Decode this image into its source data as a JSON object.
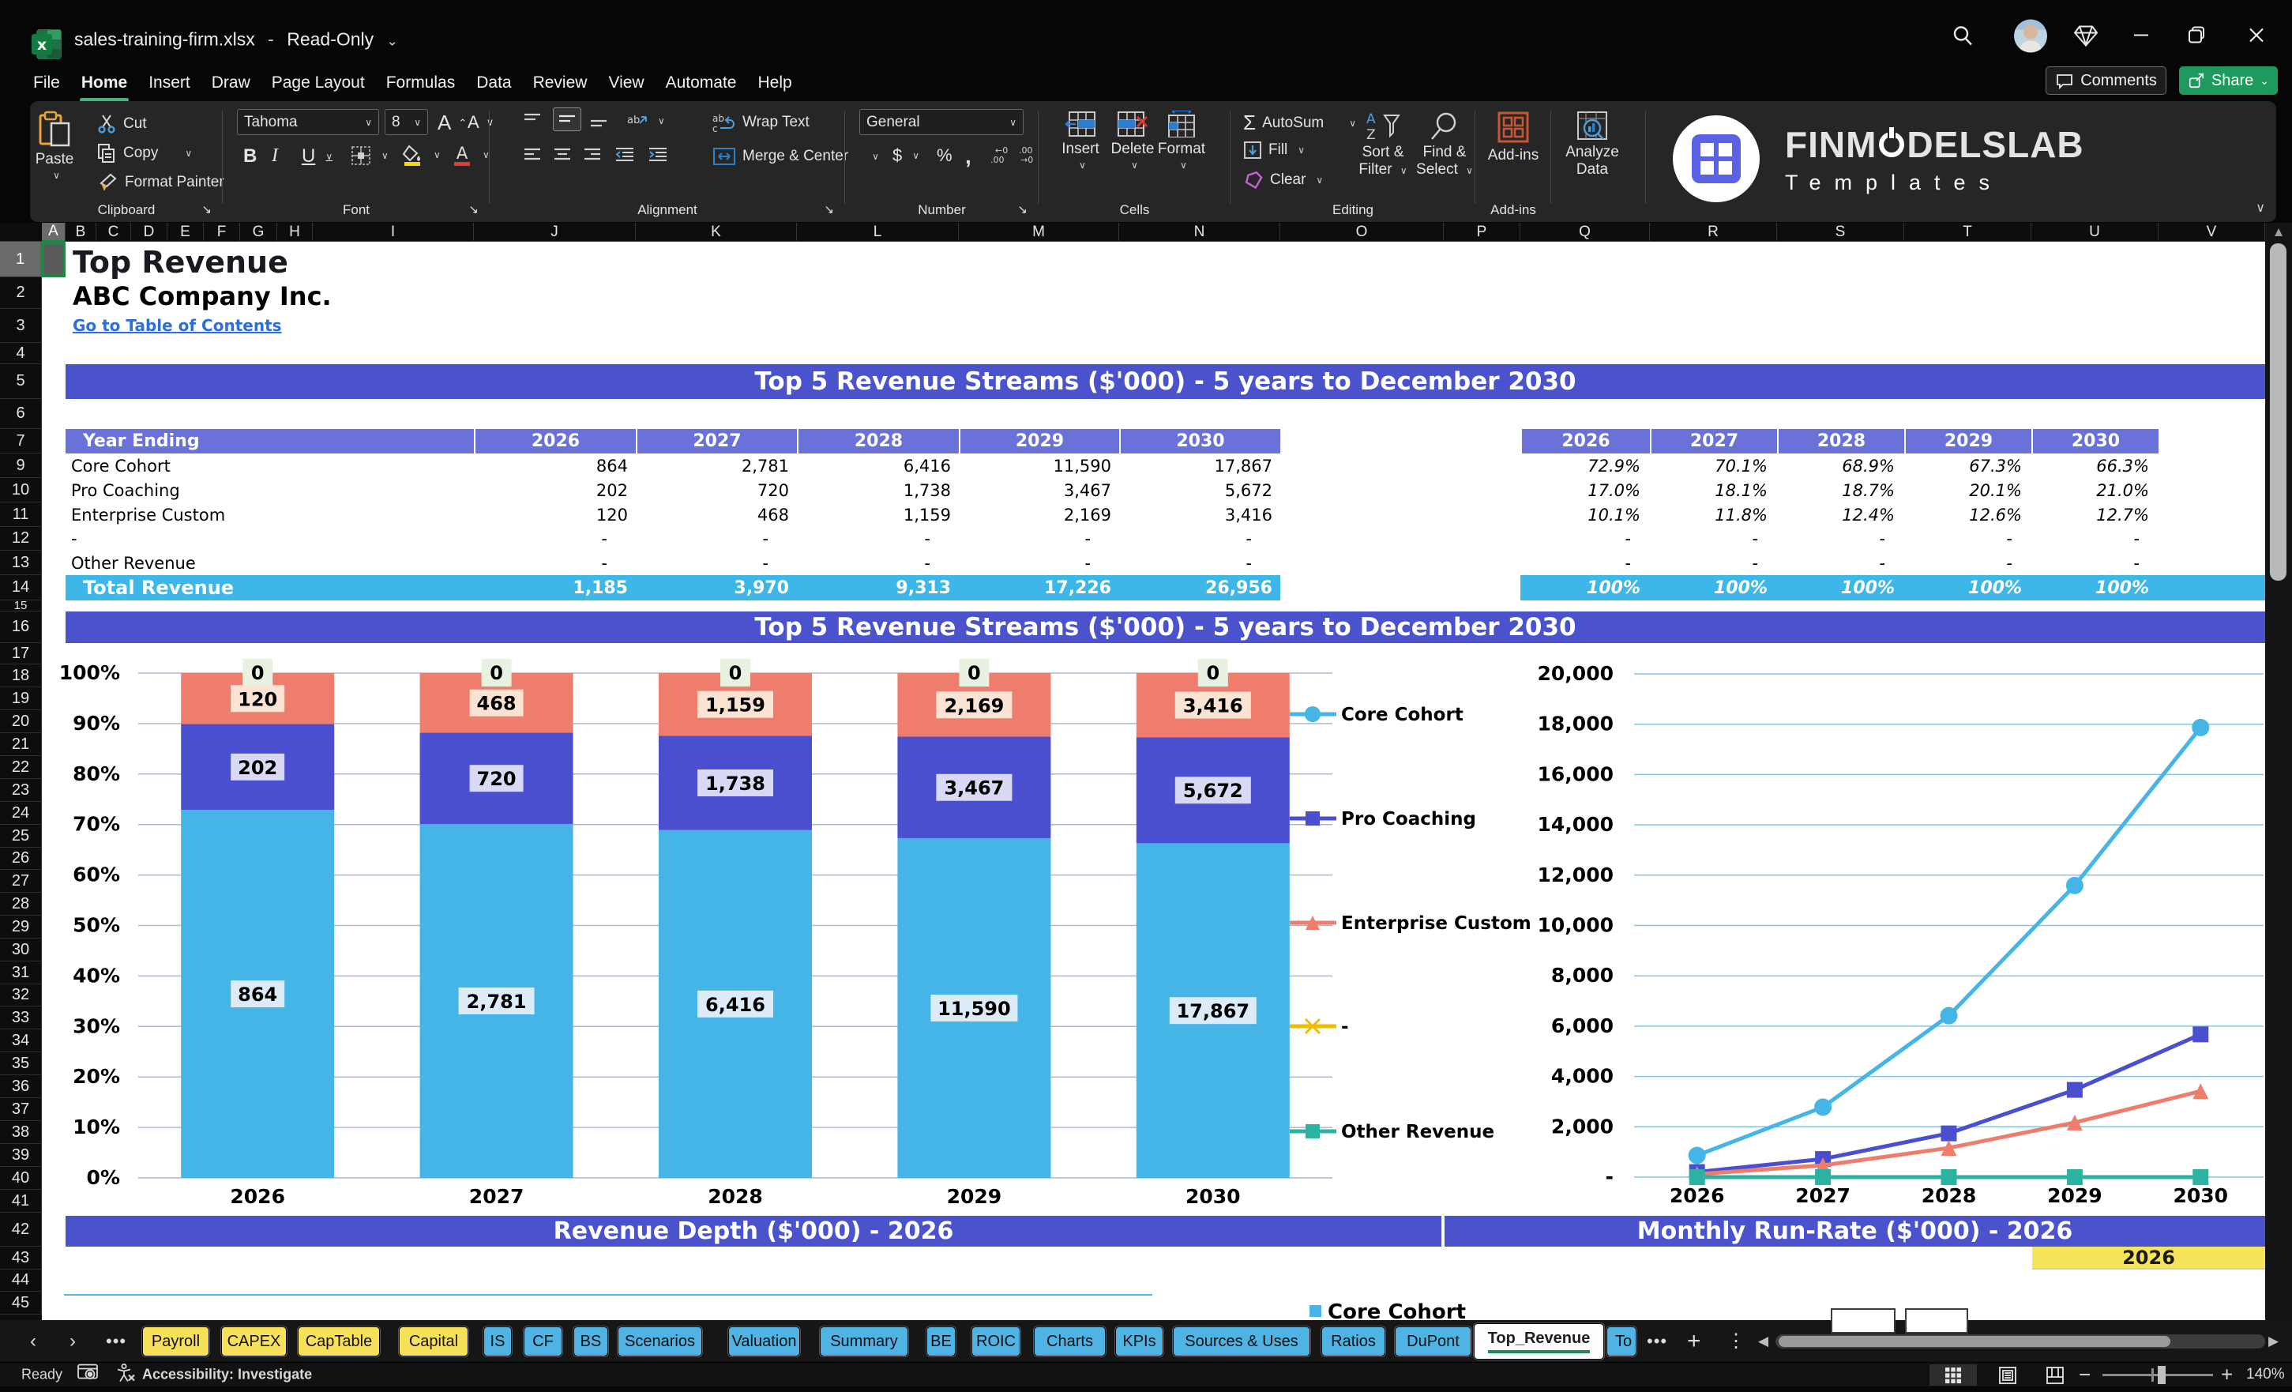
{
  "window": {
    "title": "sales-training-firm.xlsx",
    "separator": "-",
    "mode": "Read-Only"
  },
  "menu": {
    "items": [
      "File",
      "Home",
      "Insert",
      "Draw",
      "Page Layout",
      "Formulas",
      "Data",
      "Review",
      "View",
      "Automate",
      "Help"
    ],
    "active": "Home"
  },
  "actions": {
    "comments": "Comments",
    "share": "Share"
  },
  "ribbon": {
    "clipboard": {
      "label": "Clipboard",
      "paste": "Paste",
      "cut": "Cut",
      "copy": "Copy",
      "format_painter": "Format Painter"
    },
    "font": {
      "label": "Font",
      "font_name": "Tahoma",
      "font_size": "8",
      "bold": "B",
      "italic": "I",
      "underline": "U"
    },
    "alignment": {
      "label": "Alignment",
      "wrap_text": "Wrap Text",
      "merge_center": "Merge & Center"
    },
    "number": {
      "label": "Number",
      "format": "General",
      "currency": "$",
      "percent": "%",
      "comma": ","
    },
    "cells": {
      "label": "Cells",
      "insert": "Insert",
      "delete": "Delete",
      "format": "Format"
    },
    "editing": {
      "label": "Editing",
      "autosum": "AutoSum",
      "fill": "Fill",
      "clear": "Clear",
      "sort_filter": "Sort & Filter",
      "find_select": "Find & Select"
    },
    "addins_group": {
      "label": "Add-ins",
      "addins": "Add-ins",
      "analyze": "Analyze Data"
    },
    "logo": {
      "brand_pre": "FINM",
      "brand_post": "DELSLAB",
      "sub": "Templates"
    }
  },
  "sheet": {
    "column_letters": [
      "A",
      "B",
      "C",
      "D",
      "E",
      "F",
      "G",
      "H",
      "I",
      "J",
      "K",
      "L",
      "M",
      "N",
      "O",
      "P",
      "Q",
      "R",
      "S",
      "T",
      "U",
      "V"
    ],
    "row_numbers": [
      1,
      2,
      3,
      4,
      5,
      6,
      7,
      9,
      10,
      11,
      12,
      13,
      14,
      15,
      16,
      17,
      18,
      19,
      20,
      21,
      22,
      23,
      24,
      25,
      26,
      27,
      28,
      29,
      30,
      31,
      32,
      33,
      34,
      35,
      36,
      37,
      38,
      39,
      40,
      41,
      42,
      43,
      44,
      45
    ],
    "title": "Top Revenue",
    "company": "ABC Company Inc.",
    "link": "Go to Table of Contents",
    "banner_top": "Top 5 Revenue Streams ($'000) - 5 years to December 2030",
    "banner_chart": "Top 5 Revenue Streams ($'000) - 5 years to December 2030",
    "banner_depth": "Revenue Depth ($'000) - 2026",
    "banner_runrate": "Monthly Run-Rate ($'000) - 2026",
    "runrate_year": "2026",
    "table": {
      "header": "Year Ending",
      "years": [
        "2026",
        "2027",
        "2028",
        "2029",
        "2030"
      ],
      "rows": [
        {
          "label": "Core Cohort",
          "values": [
            "864",
            "2,781",
            "6,416",
            "11,590",
            "17,867"
          ]
        },
        {
          "label": "Pro Coaching",
          "values": [
            "202",
            "720",
            "1,738",
            "3,467",
            "5,672"
          ]
        },
        {
          "label": "Enterprise Custom",
          "values": [
            "120",
            "468",
            "1,159",
            "2,169",
            "3,416"
          ]
        },
        {
          "label": "-",
          "values": [
            "-",
            "-",
            "-",
            "-",
            "-"
          ]
        },
        {
          "label": "Other Revenue",
          "values": [
            "-",
            "-",
            "-",
            "-",
            "-"
          ]
        }
      ],
      "total": {
        "label": "Total Revenue",
        "values": [
          "1,185",
          "3,970",
          "9,313",
          "17,226",
          "26,956"
        ]
      }
    },
    "pct_table": {
      "years": [
        "2026",
        "2027",
        "2028",
        "2029",
        "2030"
      ],
      "rows": [
        [
          "72.9%",
          "70.1%",
          "68.9%",
          "67.3%",
          "66.3%"
        ],
        [
          "17.0%",
          "18.1%",
          "18.7%",
          "20.1%",
          "21.0%"
        ],
        [
          "10.1%",
          "11.8%",
          "12.4%",
          "12.6%",
          "12.7%"
        ],
        [
          "-",
          "-",
          "-",
          "-",
          "-"
        ],
        [
          "-",
          "-",
          "-",
          "-",
          "-"
        ]
      ],
      "total": [
        "100%",
        "100%",
        "100%",
        "100%",
        "100%"
      ]
    },
    "mini_legend": "Core Cohort"
  },
  "chart_data": [
    {
      "type": "bar",
      "stacked": true,
      "title": "Top 5 Revenue Streams ($'000) - 5 years to December 2030",
      "categories": [
        "2026",
        "2027",
        "2028",
        "2029",
        "2030"
      ],
      "series": [
        {
          "name": "Core Cohort",
          "color": "#45b5e8",
          "values": [
            864,
            2781,
            6416,
            11590,
            17867
          ],
          "pct": [
            72.9,
            70.1,
            68.9,
            67.3,
            66.3
          ],
          "labels": [
            "864",
            "2,781",
            "6,416",
            "11,590",
            "17,867"
          ],
          "label_bg": "#dcebf7"
        },
        {
          "name": "Pro Coaching",
          "color": "#4a4fd0",
          "values": [
            202,
            720,
            1738,
            3467,
            5672
          ],
          "pct": [
            17.0,
            18.1,
            18.7,
            20.1,
            21.0
          ],
          "labels": [
            "202",
            "720",
            "1,738",
            "3,467",
            "5,672"
          ],
          "label_bg": "#d8d9f4"
        },
        {
          "name": "Enterprise Custom",
          "color": "#ee7d6e",
          "values": [
            120,
            468,
            1159,
            2169,
            3416
          ],
          "pct": [
            10.1,
            11.8,
            12.4,
            12.6,
            12.7
          ],
          "labels": [
            "120",
            "468",
            "1,159",
            "2,169",
            "3,416"
          ],
          "label_bg": "#fbe3d4"
        },
        {
          "name": "Other Revenue",
          "color": "#2ab3a0",
          "values": [
            0,
            0,
            0,
            0,
            0
          ],
          "pct": [
            0,
            0,
            0,
            0,
            0
          ],
          "labels": [
            "0",
            "0",
            "0",
            "0",
            "0"
          ],
          "label_bg": "#e8f2e0"
        }
      ],
      "ylabels": [
        "0%",
        "10%",
        "20%",
        "30%",
        "40%",
        "50%",
        "60%",
        "70%",
        "80%",
        "90%",
        "100%"
      ],
      "ylim": [
        0,
        100
      ],
      "xlabel": "",
      "ylabel": ""
    },
    {
      "type": "line",
      "categories": [
        "2026",
        "2027",
        "2028",
        "2029",
        "2030"
      ],
      "series": [
        {
          "name": "Core Cohort",
          "color": "#45b5e8",
          "marker": "circle",
          "values": [
            864,
            2781,
            6416,
            11590,
            17867
          ]
        },
        {
          "name": "Pro Coaching",
          "color": "#4a4fd0",
          "marker": "square",
          "values": [
            202,
            720,
            1738,
            3467,
            5672
          ]
        },
        {
          "name": "Enterprise Custom",
          "color": "#ee7d6e",
          "marker": "triangle",
          "values": [
            120,
            468,
            1159,
            2169,
            3416
          ]
        },
        {
          "name": "-",
          "color": "#eebc00",
          "marker": "x",
          "values": null
        },
        {
          "name": "Other Revenue",
          "color": "#2ab3a0",
          "marker": "square",
          "values": [
            0,
            0,
            0,
            0,
            0
          ]
        }
      ],
      "yticks": [
        "-",
        "2,000",
        "4,000",
        "6,000",
        "8,000",
        "10,000",
        "12,000",
        "14,000",
        "16,000",
        "18,000",
        "20,000"
      ],
      "ylim": [
        0,
        20000
      ],
      "legend_position": "left"
    }
  ],
  "tabs": {
    "sheets": [
      {
        "name": "Payroll",
        "color": "yellow"
      },
      {
        "name": "CAPEX",
        "color": "yellow"
      },
      {
        "name": "CapTable",
        "color": "yellow"
      },
      {
        "name": "Capital",
        "color": "yellow"
      },
      {
        "name": "IS",
        "color": "blue"
      },
      {
        "name": "CF",
        "color": "blue"
      },
      {
        "name": "BS",
        "color": "blue"
      },
      {
        "name": "Scenarios",
        "color": "blue"
      },
      {
        "name": "Valuation",
        "color": "blue"
      },
      {
        "name": "Summary",
        "color": "blue"
      },
      {
        "name": "BE",
        "color": "blue"
      },
      {
        "name": "ROIC",
        "color": "blue"
      },
      {
        "name": "Charts",
        "color": "blue"
      },
      {
        "name": "KPIs",
        "color": "blue"
      },
      {
        "name": "Sources & Uses",
        "color": "blue"
      },
      {
        "name": "Ratios",
        "color": "blue"
      },
      {
        "name": "DuPont",
        "color": "blue"
      },
      {
        "name": "Top_Revenue",
        "color": "white",
        "active": true
      },
      {
        "name": "To",
        "color": "blue",
        "cut": true
      }
    ]
  },
  "status": {
    "ready": "Ready",
    "accessibility": "Accessibility: Investigate",
    "zoom": "140%"
  }
}
